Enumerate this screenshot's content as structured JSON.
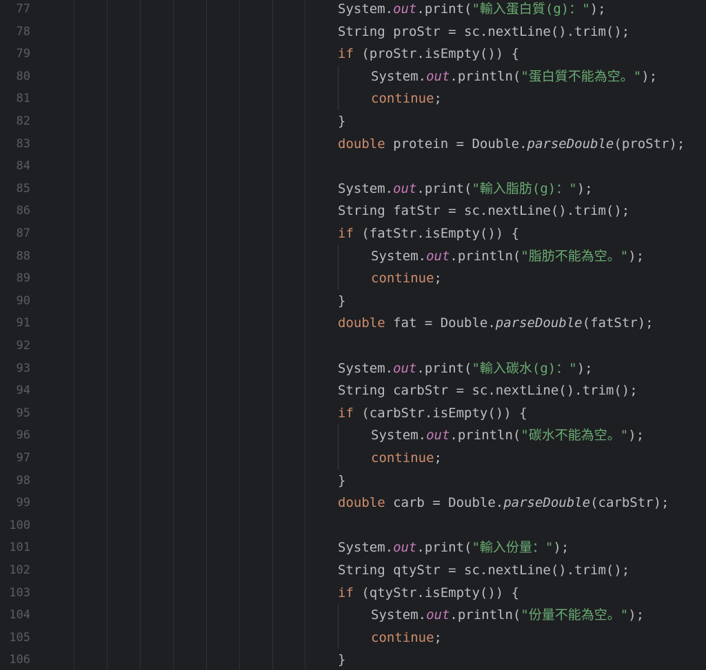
{
  "colors": {
    "background": "#1e1f22",
    "line_number": "#5a5d63",
    "default_text": "#bcbec4",
    "keyword": "#cf8e6d",
    "field": "#c77dbb",
    "string": "#6aab73",
    "indent_guide": "#2e3035"
  },
  "lines": [
    {
      "n": "77",
      "indent": 0,
      "tokens": [
        {
          "t": "System.",
          "k": "plain"
        },
        {
          "t": "out",
          "k": "field"
        },
        {
          "t": ".print(",
          "k": "plain"
        },
        {
          "t": "\"輸入蛋白質(g)：\"",
          "k": "str"
        },
        {
          "t": ");",
          "k": "plain"
        }
      ]
    },
    {
      "n": "78",
      "indent": 0,
      "tokens": [
        {
          "t": "String proStr = sc.nextLine().trim();",
          "k": "plain"
        }
      ]
    },
    {
      "n": "79",
      "indent": 0,
      "tokens": [
        {
          "t": "if",
          "k": "kw"
        },
        {
          "t": " (proStr.isEmpty()) {",
          "k": "plain"
        }
      ]
    },
    {
      "n": "80",
      "indent": 1,
      "tokens": [
        {
          "t": "System.",
          "k": "plain"
        },
        {
          "t": "out",
          "k": "field"
        },
        {
          "t": ".println(",
          "k": "plain"
        },
        {
          "t": "\"蛋白質不能為空。\"",
          "k": "str"
        },
        {
          "t": ");",
          "k": "plain"
        }
      ]
    },
    {
      "n": "81",
      "indent": 1,
      "tokens": [
        {
          "t": "continue",
          "k": "kw"
        },
        {
          "t": ";",
          "k": "plain"
        }
      ]
    },
    {
      "n": "82",
      "indent": 0,
      "tokens": [
        {
          "t": "}",
          "k": "plain"
        }
      ]
    },
    {
      "n": "83",
      "indent": 0,
      "tokens": [
        {
          "t": "double",
          "k": "kw"
        },
        {
          "t": " protein = Double.",
          "k": "plain"
        },
        {
          "t": "parseDouble",
          "k": "static"
        },
        {
          "t": "(proStr);",
          "k": "plain"
        }
      ]
    },
    {
      "n": "84",
      "indent": 0,
      "tokens": []
    },
    {
      "n": "85",
      "indent": 0,
      "tokens": [
        {
          "t": "System.",
          "k": "plain"
        },
        {
          "t": "out",
          "k": "field"
        },
        {
          "t": ".print(",
          "k": "plain"
        },
        {
          "t": "\"輸入脂肪(g)：\"",
          "k": "str"
        },
        {
          "t": ");",
          "k": "plain"
        }
      ]
    },
    {
      "n": "86",
      "indent": 0,
      "tokens": [
        {
          "t": "String fatStr = sc.nextLine().trim();",
          "k": "plain"
        }
      ]
    },
    {
      "n": "87",
      "indent": 0,
      "tokens": [
        {
          "t": "if",
          "k": "kw"
        },
        {
          "t": " (fatStr.isEmpty()) {",
          "k": "plain"
        }
      ]
    },
    {
      "n": "88",
      "indent": 1,
      "tokens": [
        {
          "t": "System.",
          "k": "plain"
        },
        {
          "t": "out",
          "k": "field"
        },
        {
          "t": ".println(",
          "k": "plain"
        },
        {
          "t": "\"脂肪不能為空。\"",
          "k": "str"
        },
        {
          "t": ");",
          "k": "plain"
        }
      ]
    },
    {
      "n": "89",
      "indent": 1,
      "tokens": [
        {
          "t": "continue",
          "k": "kw"
        },
        {
          "t": ";",
          "k": "plain"
        }
      ]
    },
    {
      "n": "90",
      "indent": 0,
      "tokens": [
        {
          "t": "}",
          "k": "plain"
        }
      ]
    },
    {
      "n": "91",
      "indent": 0,
      "tokens": [
        {
          "t": "double",
          "k": "kw"
        },
        {
          "t": " fat = Double.",
          "k": "plain"
        },
        {
          "t": "parseDouble",
          "k": "static"
        },
        {
          "t": "(fatStr);",
          "k": "plain"
        }
      ]
    },
    {
      "n": "92",
      "indent": 0,
      "tokens": []
    },
    {
      "n": "93",
      "indent": 0,
      "tokens": [
        {
          "t": "System.",
          "k": "plain"
        },
        {
          "t": "out",
          "k": "field"
        },
        {
          "t": ".print(",
          "k": "plain"
        },
        {
          "t": "\"輸入碳水(g)：\"",
          "k": "str"
        },
        {
          "t": ");",
          "k": "plain"
        }
      ]
    },
    {
      "n": "94",
      "indent": 0,
      "tokens": [
        {
          "t": "String carbStr = sc.nextLine().trim();",
          "k": "plain"
        }
      ]
    },
    {
      "n": "95",
      "indent": 0,
      "tokens": [
        {
          "t": "if",
          "k": "kw"
        },
        {
          "t": " (carbStr.isEmpty()) {",
          "k": "plain"
        }
      ]
    },
    {
      "n": "96",
      "indent": 1,
      "tokens": [
        {
          "t": "System.",
          "k": "plain"
        },
        {
          "t": "out",
          "k": "field"
        },
        {
          "t": ".println(",
          "k": "plain"
        },
        {
          "t": "\"碳水不能為空。\"",
          "k": "str"
        },
        {
          "t": ");",
          "k": "plain"
        }
      ]
    },
    {
      "n": "97",
      "indent": 1,
      "tokens": [
        {
          "t": "continue",
          "k": "kw"
        },
        {
          "t": ";",
          "k": "plain"
        }
      ]
    },
    {
      "n": "98",
      "indent": 0,
      "tokens": [
        {
          "t": "}",
          "k": "plain"
        }
      ]
    },
    {
      "n": "99",
      "indent": 0,
      "tokens": [
        {
          "t": "double",
          "k": "kw"
        },
        {
          "t": " carb = Double.",
          "k": "plain"
        },
        {
          "t": "parseDouble",
          "k": "static"
        },
        {
          "t": "(carbStr);",
          "k": "plain"
        }
      ]
    },
    {
      "n": "100",
      "indent": 0,
      "tokens": []
    },
    {
      "n": "101",
      "indent": 0,
      "tokens": [
        {
          "t": "System.",
          "k": "plain"
        },
        {
          "t": "out",
          "k": "field"
        },
        {
          "t": ".print(",
          "k": "plain"
        },
        {
          "t": "\"輸入份量：\"",
          "k": "str"
        },
        {
          "t": ");",
          "k": "plain"
        }
      ]
    },
    {
      "n": "102",
      "indent": 0,
      "tokens": [
        {
          "t": "String qtyStr = sc.nextLine().trim();",
          "k": "plain"
        }
      ]
    },
    {
      "n": "103",
      "indent": 0,
      "tokens": [
        {
          "t": "if",
          "k": "kw"
        },
        {
          "t": " (qtyStr.isEmpty()) {",
          "k": "plain"
        }
      ]
    },
    {
      "n": "104",
      "indent": 1,
      "tokens": [
        {
          "t": "System.",
          "k": "plain"
        },
        {
          "t": "out",
          "k": "field"
        },
        {
          "t": ".println(",
          "k": "plain"
        },
        {
          "t": "\"份量不能為空。\"",
          "k": "str"
        },
        {
          "t": ");",
          "k": "plain"
        }
      ]
    },
    {
      "n": "105",
      "indent": 1,
      "tokens": [
        {
          "t": "continue",
          "k": "kw"
        },
        {
          "t": ";",
          "k": "plain"
        }
      ]
    },
    {
      "n": "106",
      "indent": 0,
      "tokens": [
        {
          "t": "}",
          "k": "plain"
        }
      ]
    }
  ]
}
